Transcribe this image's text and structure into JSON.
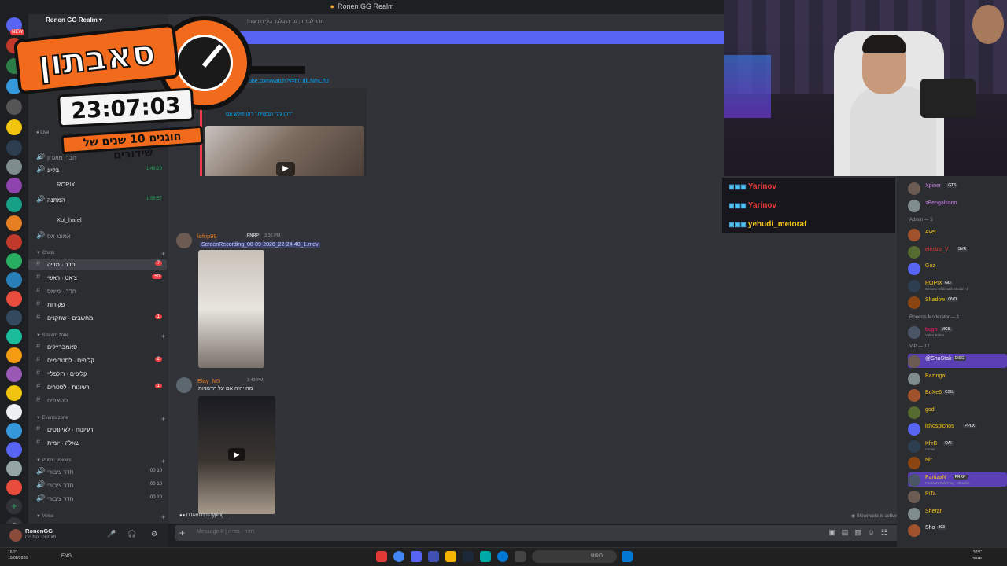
{
  "window": {
    "title": "Ronen GG Realm"
  },
  "server": {
    "name": "Ronen GG Realm"
  },
  "overlay": {
    "logo_text": "סאבתון",
    "timer": "23:07:03",
    "tagline": "חוגגים 10 שנים של שידורים"
  },
  "sidebar": {
    "live_label": "Live",
    "voice_rows": [
      {
        "label": "חברי מועדון"
      },
      {
        "label": "בליינ",
        "timer": "1:49:29"
      },
      {
        "label": "ROPIX",
        "sub": true
      },
      {
        "label": "המתנה",
        "timer": "1:56:57"
      },
      {
        "label": "Xol_harel",
        "sub": true
      },
      {
        "label": "אמונג אס"
      }
    ],
    "categories": {
      "chats": "Chats",
      "stream": "Stream zone",
      "events": "Events zone",
      "public_voice": "Public Voice's",
      "voice": "Voice"
    },
    "chats": [
      {
        "label": "חדר · מדיה",
        "count": "7",
        "selected": true
      },
      {
        "label": "צ'אט · ראשי",
        "count": "50"
      },
      {
        "label": "חדר · מימס"
      },
      {
        "label": "פקודות"
      },
      {
        "label": "מחשבים · שחקנים",
        "count": "1"
      }
    ],
    "stream": [
      {
        "label": "סאמבריילים"
      },
      {
        "label": "קליפים · לסטרימים",
        "count": "2"
      },
      {
        "label": "קליפים · רולפליי"
      },
      {
        "label": "רעיונות · לסטרים",
        "count": "1"
      },
      {
        "label": "סטאפים"
      }
    ],
    "events": [
      {
        "label": "רעיונות · לאיוונטים"
      },
      {
        "label": "שאלה · יומית"
      }
    ],
    "public_voice": [
      {
        "label": "חדר ציבורי",
        "users": "00",
        "limit": "10"
      },
      {
        "label": "חדר ציבורי",
        "users": "00",
        "limit": "10"
      },
      {
        "label": "חדר ציבורי",
        "users": "00",
        "limit": "10"
      }
    ]
  },
  "user_panel": {
    "name": "RonenGG",
    "status": "Do Not Disturb"
  },
  "chat": {
    "header": "חדר למדיה, מדיה בלבד בלי הודעות!",
    "link_text": "ube.com/watch?v=thTdlLNmCn0",
    "embed_title": "\"רונן ג'ג'י המשיח.\" רונן פולש עם",
    "messages": [
      {
        "author": "lofrip99",
        "author_color": "#e67e22",
        "badge": "FNRP",
        "time": "3:36 PM",
        "attachment": "ScreenRecording_08-09-2026_22-24-48_1.mov"
      },
      {
        "author": "Elay_M5",
        "author_color": "#e67e22",
        "time": "3:43 PM",
        "text": "מה יהיה אם על הדמויות"
      }
    ],
    "typing": "DJARO1 is typing...",
    "slowmode": "Slowmode is active",
    "composer_placeholder": "Message # | חדר · מדיה"
  },
  "stream_chat": [
    {
      "name": "Yarinov",
      "color": "#e53935"
    },
    {
      "name": "Yarinov",
      "color": "#e53935"
    },
    {
      "name": "yehudi_metoraf",
      "color": "#f5c518"
    }
  ],
  "members": {
    "top": [
      {
        "name": "Xpiner",
        "tag": "GTS",
        "color": "#c97be6"
      },
      {
        "name": "zBengalsonn",
        "color": "#c97be6"
      }
    ],
    "admin_header": "Admin — 5",
    "admins": [
      {
        "name": "Avet",
        "color": "#f5c518"
      },
      {
        "name": "electro_V",
        "tag": "SVR",
        "color": "#e53935"
      },
      {
        "name": "Goz",
        "color": "#f5c518"
      },
      {
        "name": "ROPIX",
        "tag": "GG",
        "color": "#f5c518",
        "sub": "Strikers Club with Medal +1"
      },
      {
        "name": "Shadow",
        "tag": "OVO",
        "color": "#f5c518"
      }
    ],
    "mod_header": "Ronen's Moderator — 1",
    "mods": [
      {
        "name": "bugo",
        "tag": "MCIL",
        "color": "#e91e63",
        "sub": "Video Editor"
      }
    ],
    "vip_header": "VIP — 12",
    "vips": [
      {
        "name": "@ShoStak",
        "tag": "DISC",
        "color": "#f5f5f5",
        "highlight": true
      },
      {
        "name": "Bazinga!",
        "color": "#f5c518"
      },
      {
        "name": "BoXe6",
        "tag": "CSIL",
        "color": "#f5c518"
      },
      {
        "name": "god",
        "color": "#f5c518"
      },
      {
        "name": "ichospichos",
        "tag": "PPLX",
        "color": "#f5c518"
      },
      {
        "name": "KfirB",
        "tag": "OAI",
        "color": "#f5c518",
        "sub": "runnin"
      },
      {
        "name": "Nir",
        "color": "#f5c518"
      },
      {
        "name": "PartizaN",
        "tag": "PRRP",
        "color": "#f5c518",
        "sub": "PartizaN RolePlay - Allowlist",
        "highlight": true
      },
      {
        "name": "PiTa",
        "color": "#f5c518"
      },
      {
        "name": "Sheran",
        "color": "#f5c518"
      },
      {
        "name": "Sho",
        "tag": "303",
        "color": "#f5f5f5"
      }
    ]
  },
  "taskbar": {
    "time": "16:21",
    "date": "10/08/2026",
    "lang": "ENG",
    "search_placeholder": "חיפוש",
    "weather_temp": "32°C",
    "weather_desc": "שמשי"
  },
  "colors": {
    "accent": "#5865f2",
    "overlay_orange": "#f26b1d",
    "mention_red": "#f23f43"
  }
}
